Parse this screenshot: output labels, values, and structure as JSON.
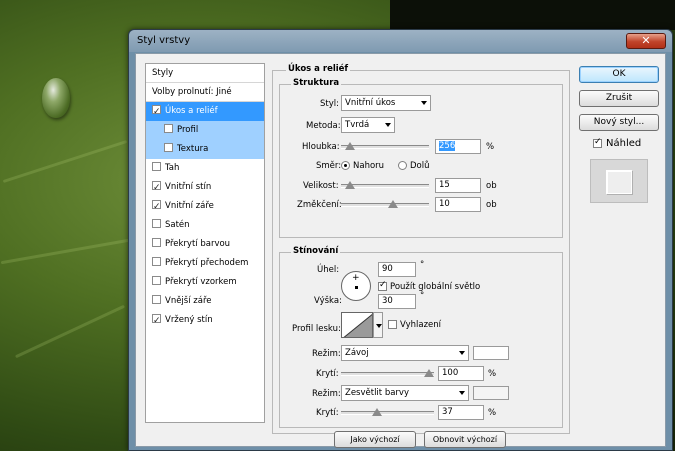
{
  "window": {
    "title": "Styl vrstvy",
    "close_glyph": "✕"
  },
  "sidebar": {
    "items": [
      {
        "label": "Styly",
        "checked": null
      },
      {
        "label": "Volby prolnutí: Jiné",
        "checked": null
      },
      {
        "label": "Úkos a reliéf",
        "checked": true
      },
      {
        "label": "Profil",
        "checked": false
      },
      {
        "label": "Textura",
        "checked": false
      },
      {
        "label": "Tah",
        "checked": false
      },
      {
        "label": "Vnitřní stín",
        "checked": true
      },
      {
        "label": "Vnitřní záře",
        "checked": true
      },
      {
        "label": "Satén",
        "checked": false
      },
      {
        "label": "Překrytí barvou",
        "checked": false
      },
      {
        "label": "Překrytí přechodem",
        "checked": false
      },
      {
        "label": "Překrytí vzorkem",
        "checked": false
      },
      {
        "label": "Vnější záře",
        "checked": false
      },
      {
        "label": "Vržený stín",
        "checked": true
      }
    ]
  },
  "bevel": {
    "section_title": "Úkos a reliéf",
    "structure": {
      "group_title": "Struktura",
      "style_label": "Styl:",
      "style_value": "Vnitřní úkos",
      "technique_label": "Metoda:",
      "technique_value": "Tvrdá",
      "depth_label": "Hloubka:",
      "depth_value": "256",
      "depth_unit": "%",
      "depth_slider": 0.05,
      "direction_label": "Směr:",
      "dir_up": "Nahoru",
      "dir_down": "Dolů",
      "dir_selected": "up",
      "size_label": "Velikost:",
      "size_value": "15",
      "size_unit": "ob",
      "size_slider": 0.05,
      "soften_label": "Změkčení:",
      "soften_value": "10",
      "soften_unit": "ob",
      "soften_slider": 0.6
    },
    "shading": {
      "group_title": "Stínování",
      "angle_label": "Úhel:",
      "angle_value": "90",
      "angle_unit": "°",
      "global_light_label": "Použít globální světlo",
      "global_light_checked": true,
      "altitude_label": "Výška:",
      "altitude_value": "30",
      "altitude_unit": "°",
      "gloss_label": "Profil lesku:",
      "antialias_label": "Vyhlazení",
      "antialias_checked": false,
      "highlight_mode_label": "Režim:",
      "highlight_mode_value": "Závoj",
      "highlight_opacity_label": "Krytí:",
      "highlight_opacity_value": "100",
      "highlight_opacity_unit": "%",
      "highlight_opacity_slider": 1.0,
      "highlight_color": "#ffffff",
      "shadow_mode_label": "Režim:",
      "shadow_mode_value": "Zesvětlit barvy",
      "shadow_opacity_label": "Krytí:",
      "shadow_opacity_value": "37",
      "shadow_opacity_unit": "%",
      "shadow_opacity_slider": 0.37,
      "shadow_color": "#f4f4f4"
    },
    "make_default": "Jako výchozí",
    "reset_default": "Obnovit výchozí"
  },
  "actions": {
    "ok": "OK",
    "cancel": "Zrušit",
    "new_style": "Nový styl...",
    "preview_label": "Náhled",
    "preview_checked": true
  }
}
